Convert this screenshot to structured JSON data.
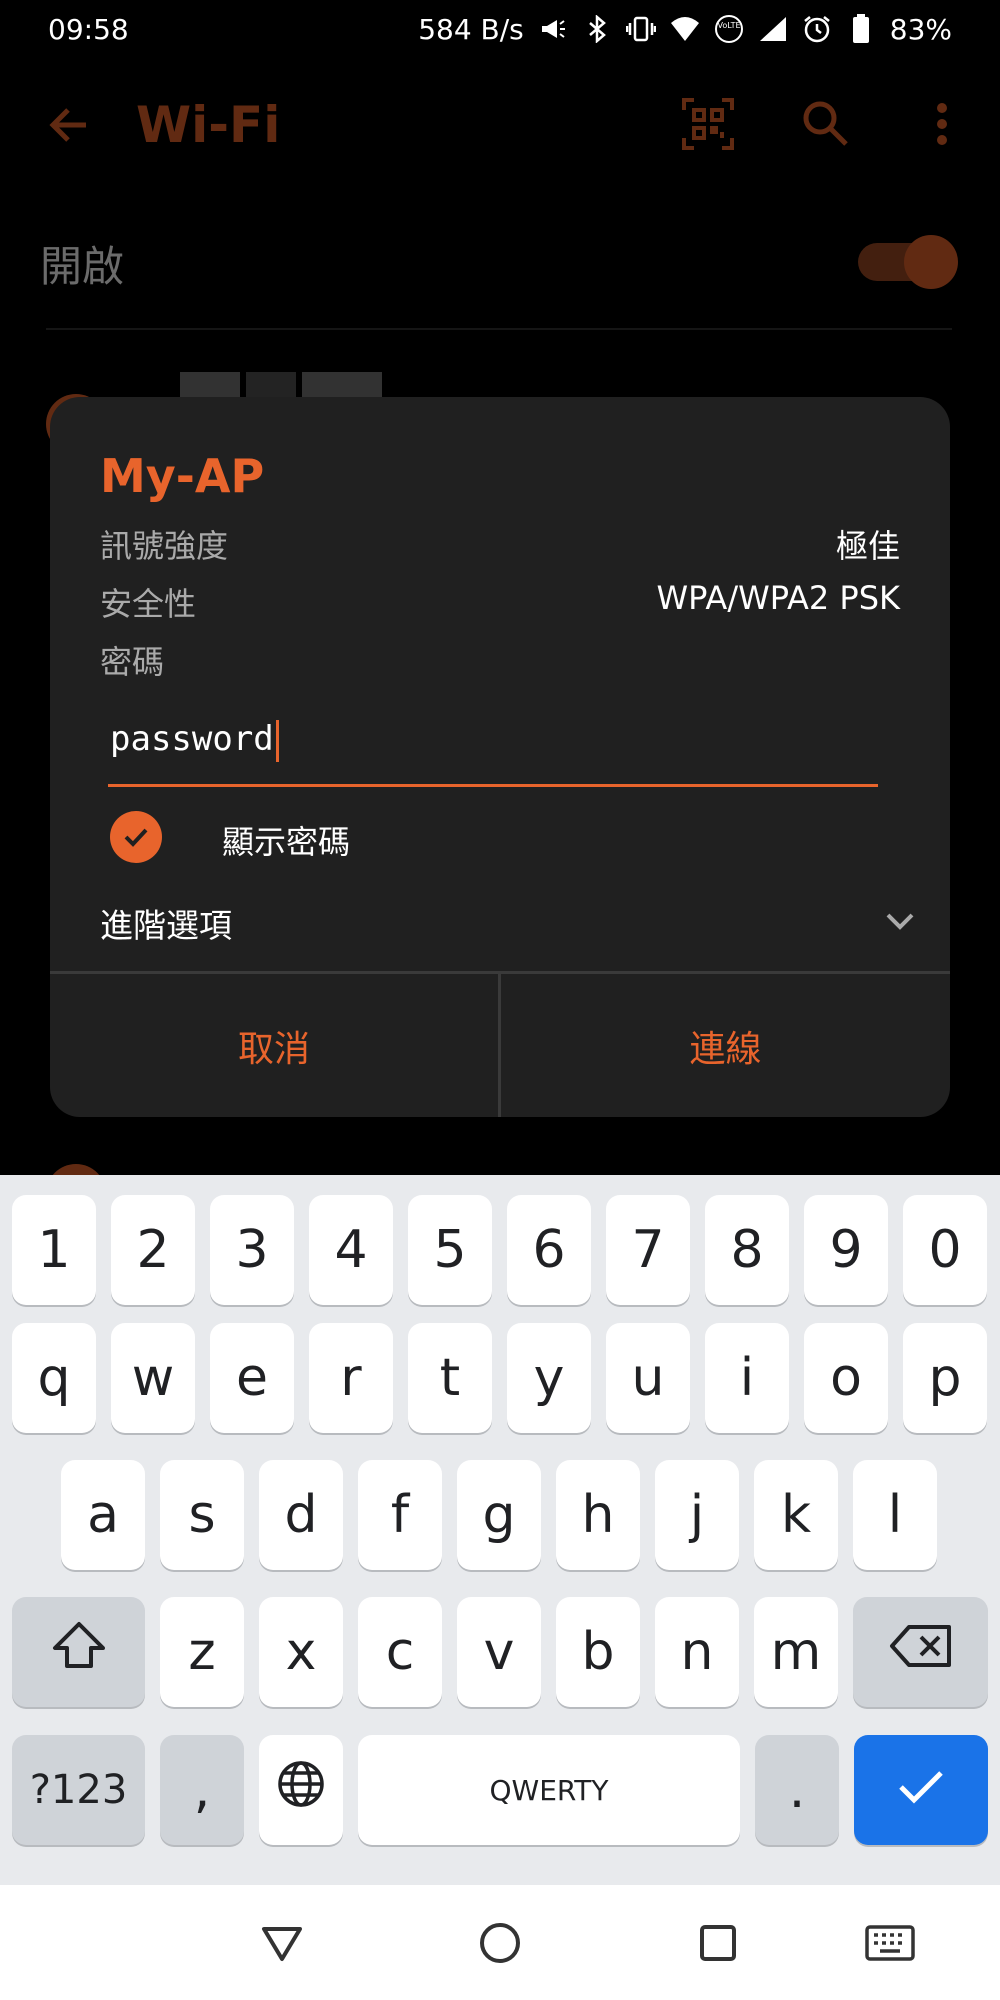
{
  "status_bar": {
    "time": "09:58",
    "net_speed": "584 B/s",
    "battery": "83%",
    "icons": [
      "megaphone-icon",
      "bluetooth-icon",
      "vibrate-icon",
      "wifi-icon",
      "volte-icon",
      "signal-icon",
      "alarm-icon",
      "battery-icon"
    ]
  },
  "app_bar": {
    "title": "Wi-Fi"
  },
  "wifi_switch": {
    "label": "開啟",
    "on": true
  },
  "dialog": {
    "title": "My-AP",
    "signal_label": "訊號強度",
    "signal_value": "極佳",
    "security_label": "安全性",
    "security_value": "WPA/WPA2 PSK",
    "password_label": "密碼",
    "password_value": "password",
    "show_password_label": "顯示密碼",
    "show_password_checked": true,
    "advanced_label": "進階選項",
    "cancel_label": "取消",
    "connect_label": "連線"
  },
  "keyboard": {
    "row_numbers": [
      "1",
      "2",
      "3",
      "4",
      "5",
      "6",
      "7",
      "8",
      "9",
      "0"
    ],
    "row_top": [
      "q",
      "w",
      "e",
      "r",
      "t",
      "y",
      "u",
      "i",
      "o",
      "p"
    ],
    "row_mid": [
      "a",
      "s",
      "d",
      "f",
      "g",
      "h",
      "j",
      "k",
      "l"
    ],
    "row_bottom": [
      "z",
      "x",
      "c",
      "v",
      "b",
      "n",
      "m"
    ],
    "symbols_label": "?123",
    "comma_label": ",",
    "space_label": "QWERTY",
    "period_label": "."
  },
  "colors": {
    "accent": "#e8642c",
    "dialog_bg": "#202020",
    "keyboard_bg": "#e8eaed",
    "enter_key": "#1a73e8"
  }
}
